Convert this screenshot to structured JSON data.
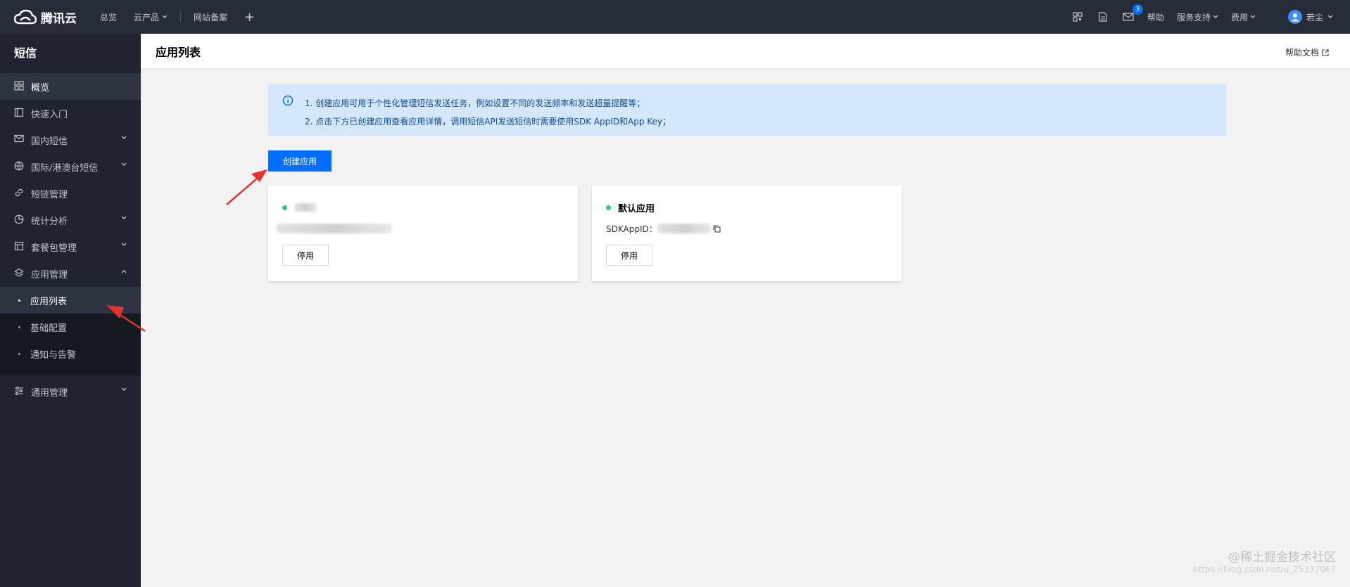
{
  "topbar": {
    "brand": "腾讯云",
    "nav": [
      {
        "label": "总览"
      },
      {
        "label": "云产品"
      },
      {
        "label": "网站备案"
      }
    ],
    "plus": "+",
    "mail_badge": "3",
    "help": "帮助",
    "service": "服务支持",
    "billing": "费用",
    "user": "若尘"
  },
  "sidebar": {
    "title": "短信",
    "items": [
      {
        "label": "概览"
      },
      {
        "label": "快速入门"
      },
      {
        "label": "国内短信"
      },
      {
        "label": "国际/港澳台短信"
      },
      {
        "label": "短链管理"
      },
      {
        "label": "统计分析"
      },
      {
        "label": "套餐包管理"
      },
      {
        "label": "应用管理"
      }
    ],
    "app_sub": [
      {
        "label": "应用列表"
      },
      {
        "label": "基础配置"
      },
      {
        "label": "通知与告警"
      }
    ],
    "general": "通用管理"
  },
  "header": {
    "title": "应用列表",
    "help_doc": "帮助文档"
  },
  "info": {
    "line1": "1. 创建应用可用于个性化管理短信发送任务，例如设置不同的发送频率和发送超量提醒等；",
    "line2": "2. 点击下方已创建应用查看应用详情，调用短信API发送短信时需要使用SDK AppID和App Key；"
  },
  "create_button": "创建应用",
  "cards": [
    {
      "name": "",
      "stop": "停用"
    },
    {
      "name": "默认应用",
      "appid_label": "SDKAppID：",
      "stop": "停用"
    }
  ],
  "watermark": {
    "text": "@稀土掘金技术社区",
    "url": "https://blog.csdn.net/u_25337067"
  },
  "colors": {
    "topbar": "#262c38",
    "sidebar": "#1f2430",
    "primary": "#006eff",
    "info_bg": "#d5e7fd",
    "status_green": "#29cc85",
    "arrow": "#e6322e"
  }
}
